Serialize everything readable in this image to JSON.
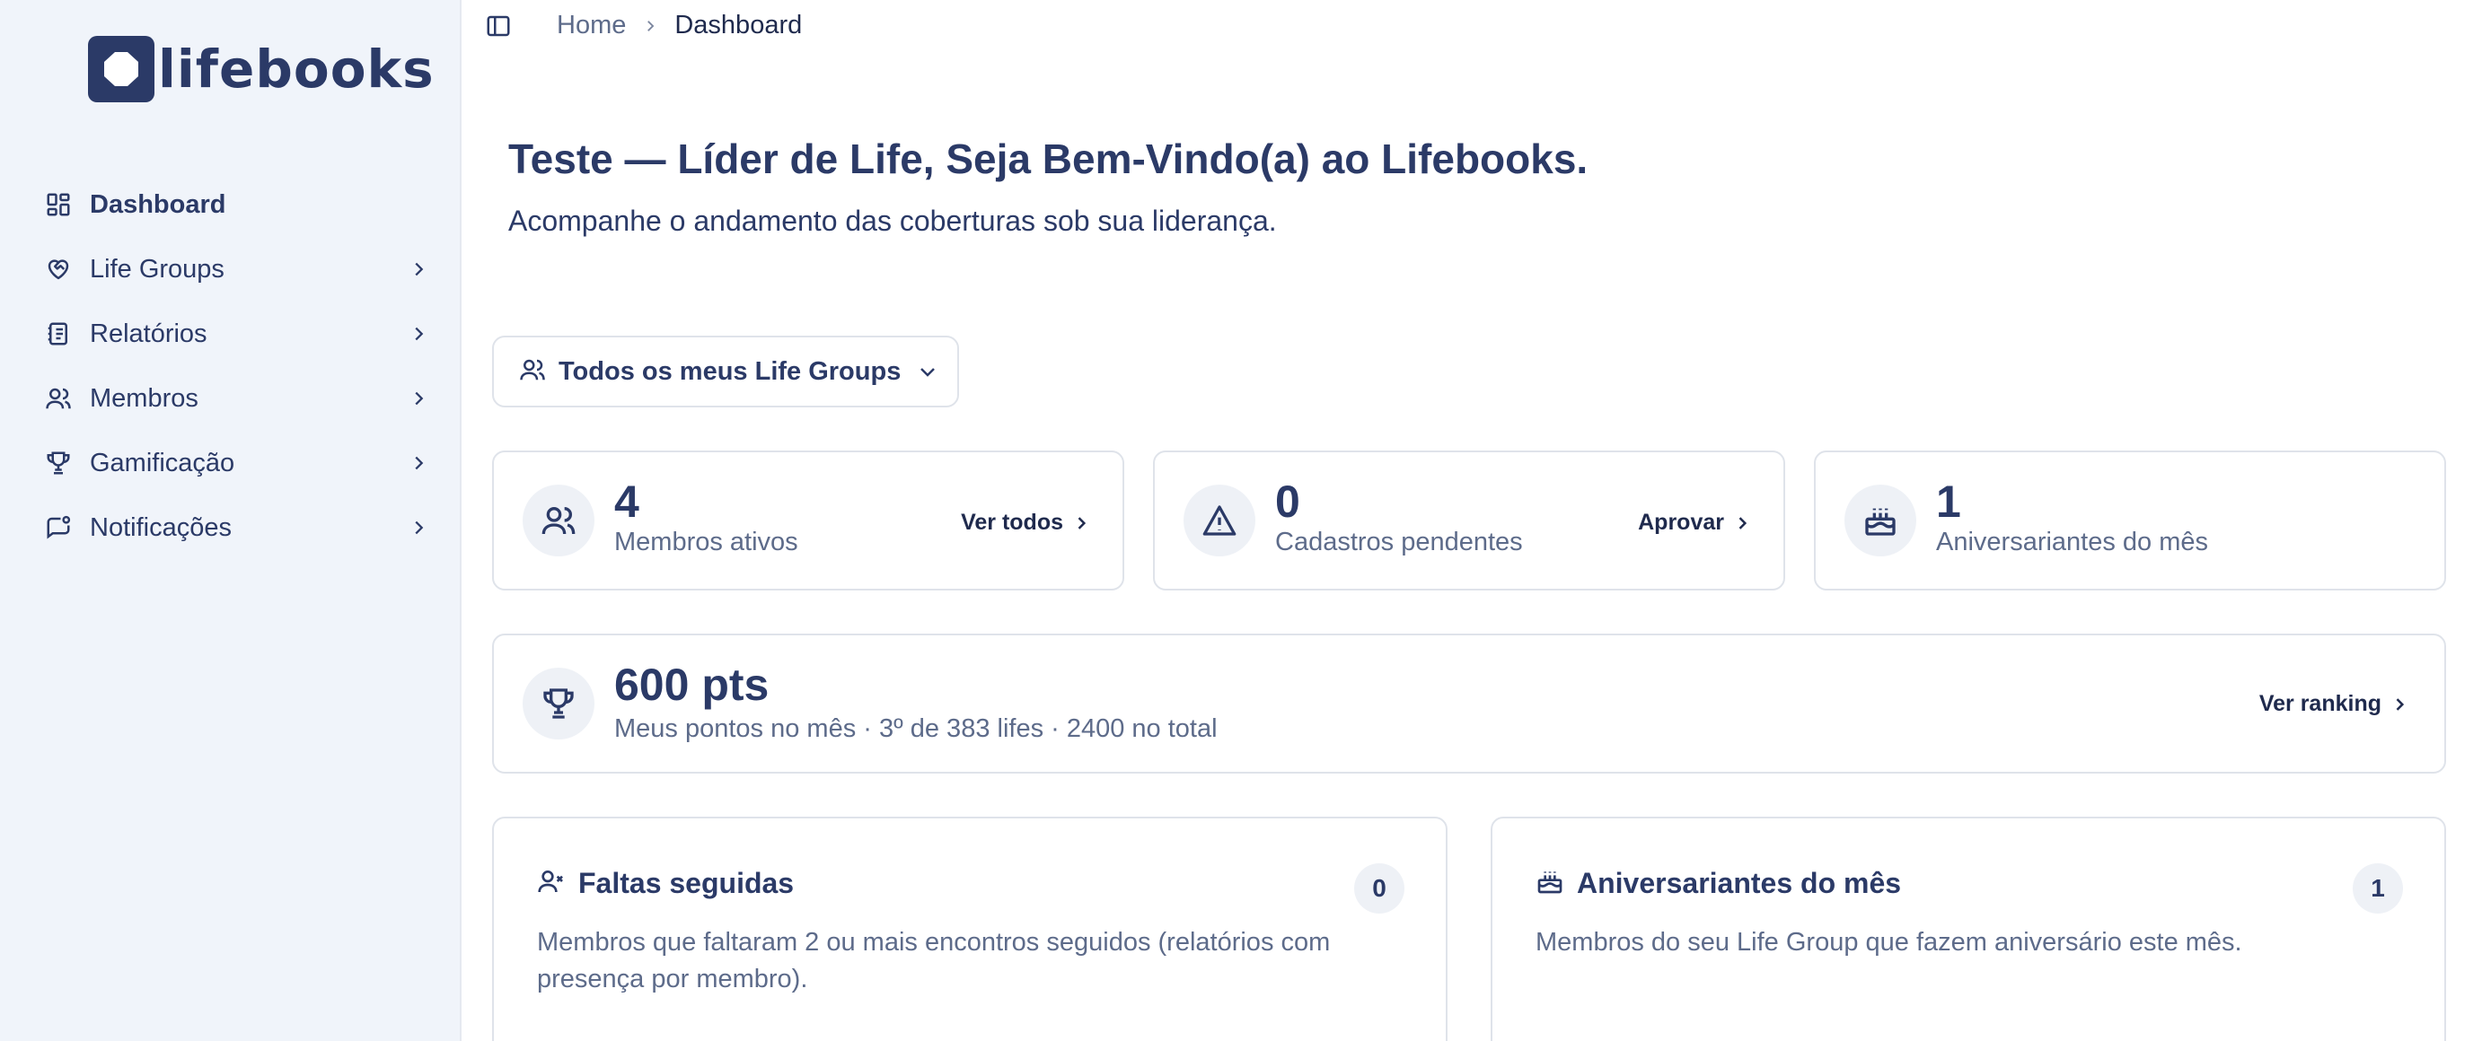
{
  "brand": {
    "name": "lifebooks"
  },
  "sidebar": {
    "items": [
      {
        "label": "Dashboard",
        "icon": "dashboard-icon",
        "active": true
      },
      {
        "label": "Life Groups",
        "icon": "heart-handshake-icon"
      },
      {
        "label": "Relatórios",
        "icon": "notebook-icon"
      },
      {
        "label": "Membros",
        "icon": "users-icon"
      },
      {
        "label": "Gamificação",
        "icon": "trophy-icon"
      },
      {
        "label": "Notificações",
        "icon": "message-badge-icon"
      }
    ]
  },
  "breadcrumb": {
    "home": "Home",
    "current": "Dashboard"
  },
  "header": {
    "title": "Teste — Líder de Life, Seja Bem-Vindo(a) ao Lifebooks.",
    "subtitle": "Acompanhe o andamento das coberturas sob sua liderança."
  },
  "filter": {
    "label": "Todos os meus Life Groups"
  },
  "stats": [
    {
      "value": "4",
      "label": "Membros ativos",
      "link": "Ver todos",
      "icon": "users-icon"
    },
    {
      "value": "0",
      "label": "Cadastros pendentes",
      "link": "Aprovar",
      "icon": "warning-icon"
    },
    {
      "value": "1",
      "label": "Aniversariantes do mês",
      "icon": "cake-icon"
    }
  ],
  "points": {
    "value": "600 pts",
    "subtitle": "Meus pontos no mês · 3º de 383 lifes · 2400 no total",
    "link": "Ver ranking"
  },
  "panels": [
    {
      "title": "Faltas seguidas",
      "count": "0",
      "description": "Membros que faltaram 2 ou mais encontros seguidos (relatórios com presença por membro).",
      "icon": "user-x-icon"
    },
    {
      "title": "Aniversariantes do mês",
      "count": "1",
      "description": "Membros do seu Life Group que fazem aniversário este mês.",
      "icon": "cake-icon"
    }
  ],
  "colors": {
    "primary": "#2b3a67",
    "muted": "#5d6b8a",
    "sidebar_bg": "#f0f4fa",
    "border": "#dfe3ea"
  }
}
